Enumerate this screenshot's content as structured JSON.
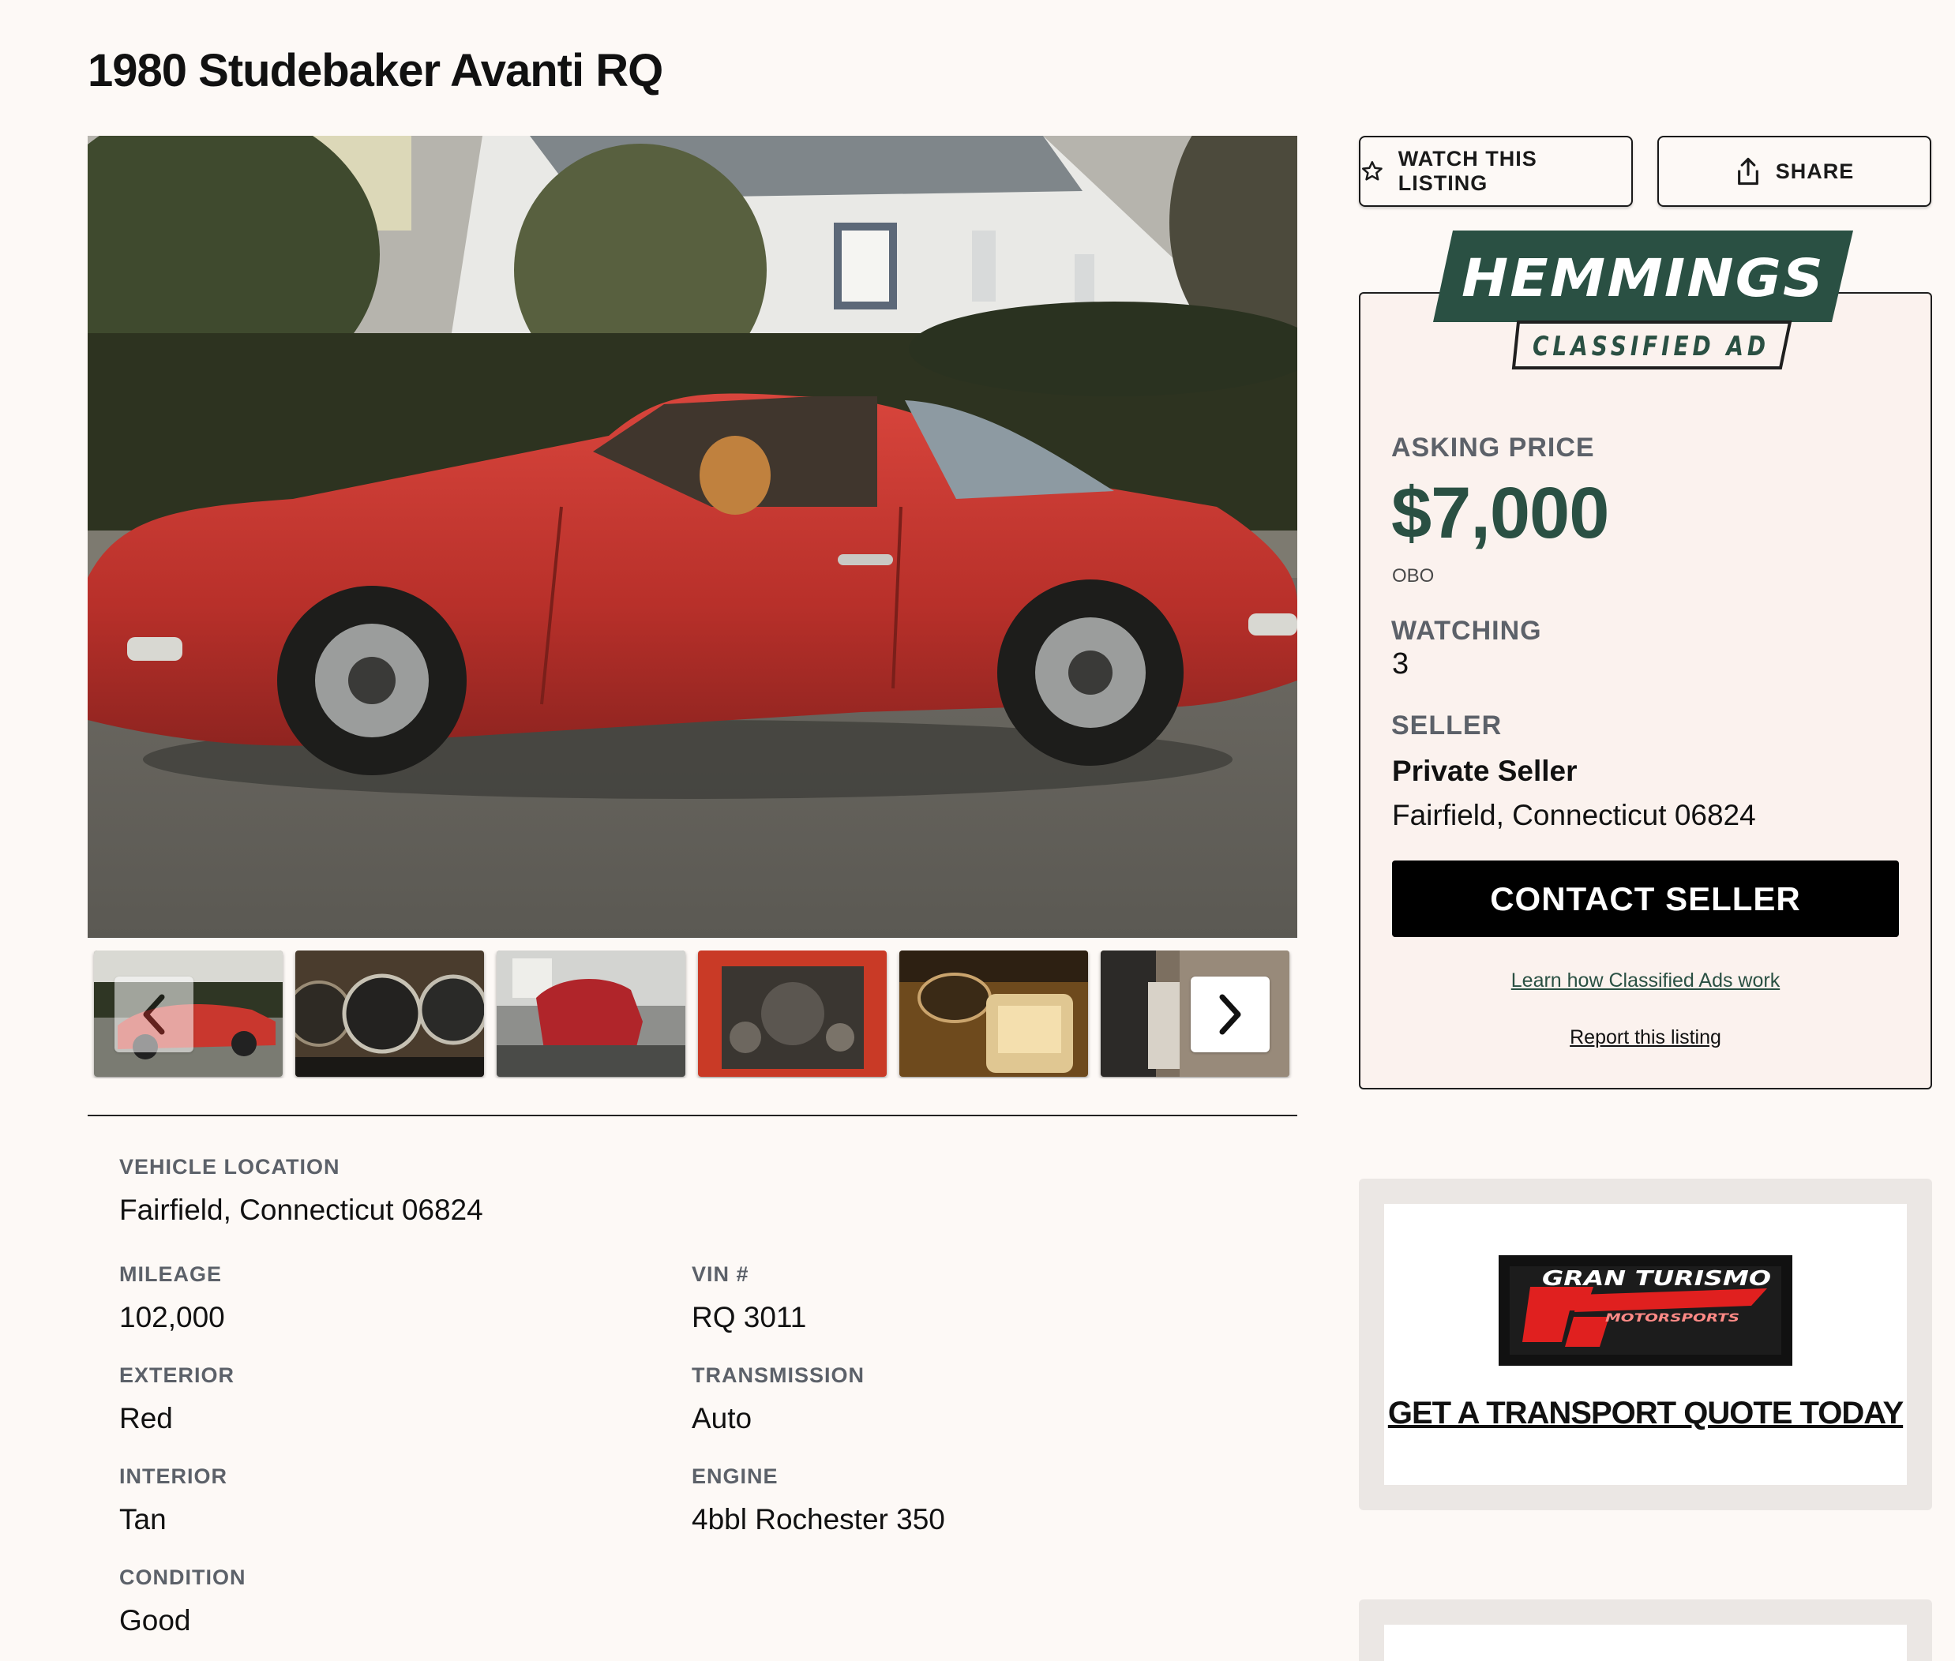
{
  "listing": {
    "title": "1980 Studebaker Avanti RQ"
  },
  "gallery": {
    "thumbnail_count": 6,
    "icons": {
      "prev": "chevron-left-icon",
      "next": "chevron-right-icon"
    }
  },
  "actions": {
    "watch_label": "WATCH THIS LISTING",
    "share_label": "SHARE",
    "icons": {
      "watch": "star-outline-icon",
      "share": "share-upload-icon"
    }
  },
  "classified": {
    "brand": "HEMMINGS",
    "badge": "CLASSIFIED AD",
    "asking_price_label": "ASKING PRICE",
    "price": "$7,000",
    "price_note": "OBO",
    "watching_label": "WATCHING",
    "watching_count": "3",
    "seller_label": "SELLER",
    "seller_name": "Private Seller",
    "seller_location": "Fairfield, Connecticut 06824",
    "contact_label": "CONTACT SELLER",
    "learn_link": "Learn how Classified Ads work",
    "report_link": "Report this listing",
    "accent_color": "#2a5043"
  },
  "specs": {
    "vehicle_location_label": "VEHICLE LOCATION",
    "vehicle_location": "Fairfield, Connecticut 06824",
    "mileage_label": "MILEAGE",
    "mileage": "102,000",
    "vin_label": "VIN #",
    "vin": "RQ 3011",
    "exterior_label": "EXTERIOR",
    "exterior": "Red",
    "transmission_label": "TRANSMISSION",
    "transmission": "Auto",
    "interior_label": "INTERIOR",
    "interior": "Tan",
    "engine_label": "ENGINE",
    "engine": "4bbl Rochester 350",
    "condition_label": "CONDITION",
    "condition": "Good"
  },
  "ad": {
    "brand_top": "GRAN TURISMO",
    "brand_sub": "MOTORSPORTS",
    "cta": "GET A TRANSPORT QUOTE TODAY"
  }
}
